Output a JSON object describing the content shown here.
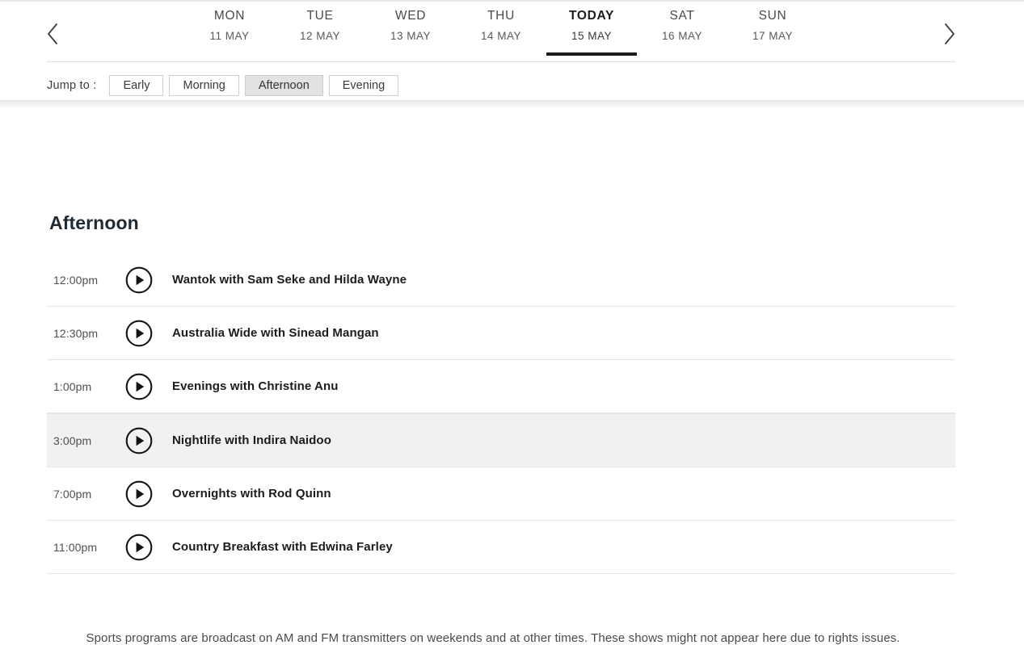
{
  "header": {
    "prev_arrow": "chevron-left",
    "next_arrow": "chevron-right",
    "days": [
      {
        "dow": "MON",
        "date": "11 MAY",
        "active": false
      },
      {
        "dow": "TUE",
        "date": "12 MAY",
        "active": false
      },
      {
        "dow": "WED",
        "date": "13 MAY",
        "active": false
      },
      {
        "dow": "THU",
        "date": "14 MAY",
        "active": false
      },
      {
        "dow": "TODAY",
        "date": "15 MAY",
        "active": true
      },
      {
        "dow": "SAT",
        "date": "16 MAY",
        "active": false
      },
      {
        "dow": "SUN",
        "date": "17 MAY",
        "active": false
      }
    ],
    "jump": {
      "label": "Jump to :",
      "buttons": [
        {
          "label": "Early",
          "active": false
        },
        {
          "label": "Morning",
          "active": false
        },
        {
          "label": "Afternoon",
          "active": true
        },
        {
          "label": "Evening",
          "active": false
        }
      ]
    }
  },
  "main": {
    "section_title": "Afternoon",
    "programs": [
      {
        "time": "12:00pm",
        "title": "Wantok with Sam Seke and Hilda Wayne",
        "highlight": false
      },
      {
        "time": "12:30pm",
        "title": "Australia Wide with Sinead Mangan",
        "highlight": false
      },
      {
        "time": "1:00pm",
        "title": "Evenings with Christine Anu",
        "highlight": false
      },
      {
        "time": "3:00pm",
        "title": "Nightlife with Indira Naidoo",
        "highlight": true
      },
      {
        "time": "7:00pm",
        "title": "Overnights with Rod Quinn",
        "highlight": false
      },
      {
        "time": "11:00pm",
        "title": "Country Breakfast with Edwina Farley",
        "highlight": false
      }
    ]
  },
  "footer": {
    "note": "Sports programs are broadcast on AM and FM transmitters on weekends and at other times. These shows might not appear here due to rights issues."
  },
  "colors": {
    "active_underline": "#1c1c1c",
    "row_highlight": "#f1f1f1",
    "divider": "#e4e4e4",
    "jump_active_bg": "#e2e2e2"
  }
}
